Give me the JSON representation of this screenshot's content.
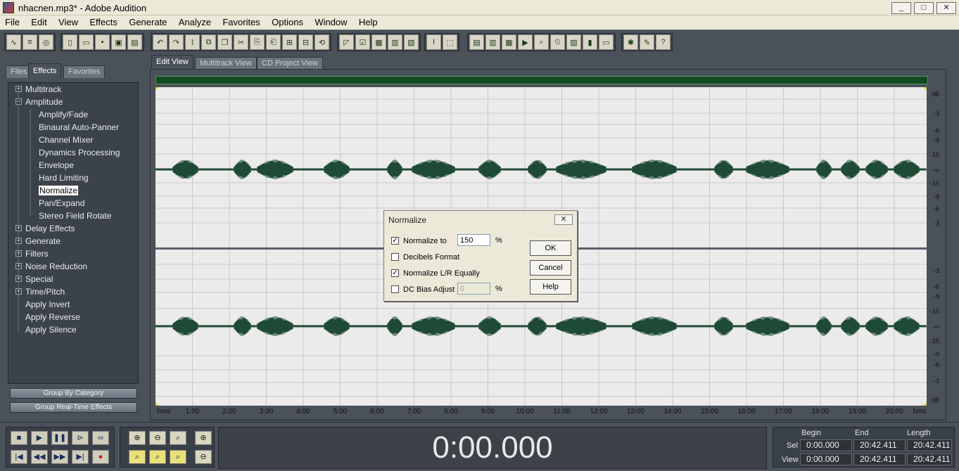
{
  "window": {
    "title": "nhacnen.mp3* - Adobe Audition",
    "controls": {
      "minimize": "_",
      "maximize": "□",
      "close": "✕"
    }
  },
  "menu": [
    "File",
    "Edit",
    "View",
    "Effects",
    "Generate",
    "Analyze",
    "Favorites",
    "Options",
    "Window",
    "Help"
  ],
  "left_panel": {
    "tabs": [
      "Files",
      "Effects",
      "Favorites"
    ],
    "active_tab": "Effects",
    "tree": [
      {
        "label": "Multitrack",
        "level": 0,
        "expander": "+"
      },
      {
        "label": "Amplitude",
        "level": 0,
        "expander": "−"
      },
      {
        "label": "Amplify/Fade",
        "level": 1
      },
      {
        "label": "Binaural Auto-Panner",
        "level": 1
      },
      {
        "label": "Channel Mixer",
        "level": 1
      },
      {
        "label": "Dynamics Processing",
        "level": 1
      },
      {
        "label": "Envelope",
        "level": 1
      },
      {
        "label": "Hard Limiting",
        "level": 1
      },
      {
        "label": "Normalize",
        "level": 1,
        "selected": true
      },
      {
        "label": "Pan/Expand",
        "level": 1
      },
      {
        "label": "Stereo Field Rotate",
        "level": 1
      },
      {
        "label": "Delay Effects",
        "level": 0,
        "expander": "+"
      },
      {
        "label": "Generate",
        "level": 0,
        "expander": "+"
      },
      {
        "label": "Filters",
        "level": 0,
        "expander": "+"
      },
      {
        "label": "Noise Reduction",
        "level": 0,
        "expander": "+"
      },
      {
        "label": "Special",
        "level": 0,
        "expander": "+"
      },
      {
        "label": "Time/Pitch",
        "level": 0,
        "expander": "+"
      },
      {
        "label": "Apply Invert",
        "level": 0
      },
      {
        "label": "Apply Reverse",
        "level": 0
      },
      {
        "label": "Apply Silence",
        "level": 0
      }
    ],
    "buttons": {
      "group_by_category": "Group By Category",
      "group_realtime": "Group Real-Time Effects"
    }
  },
  "view_tabs": [
    "Edit View",
    "Multitrack View",
    "CD Project View"
  ],
  "waveform": {
    "db_scale_top": [
      "dB",
      "-3",
      "-6",
      "-9",
      "-15",
      "-∞",
      "-15",
      "-9",
      "-6",
      "-3"
    ],
    "db_scale_bottom": [
      "-3",
      "-6",
      "-9",
      "-15",
      "-∞",
      "-15",
      "-9",
      "-6",
      "-3",
      "dB"
    ],
    "time_ruler": [
      "hms",
      "1:00",
      "2:00",
      "3:00",
      "4:00",
      "5:00",
      "6:00",
      "7:00",
      "8:00",
      "9:00",
      "10:00",
      "11:00",
      "12:00",
      "13:00",
      "14:00",
      "15:00",
      "16:00",
      "17:00",
      "18:00",
      "19:00",
      "20:00",
      "hms"
    ],
    "colors": {
      "background": "#ebebeb",
      "wave": "#1f4a35",
      "grid": "#c8c8c8"
    }
  },
  "dialog": {
    "title": "Normalize",
    "close": "✕",
    "normalize_to": {
      "label": "Normalize to",
      "checked": true,
      "value": "150",
      "unit": "%"
    },
    "decibels_format": {
      "label": "Decibels Format",
      "checked": false
    },
    "normalize_lr": {
      "label": "Normalize L/R Equally",
      "checked": true
    },
    "dc_bias": {
      "label": "DC Bias Adjust",
      "checked": false,
      "value": "0",
      "unit": "%"
    },
    "buttons": {
      "ok": "OK",
      "cancel": "Cancel",
      "help": "Help"
    }
  },
  "transport": {
    "time": "0:00.000",
    "selection": {
      "headers": {
        "begin": "Begin",
        "end": "End",
        "length": "Length"
      },
      "sel": {
        "label": "Sel",
        "begin": "0:00.000",
        "end": "20:42.411",
        "length": "20:42.411"
      },
      "view": {
        "label": "View",
        "begin": "0:00.000",
        "end": "20:42.411",
        "length": "20:42.411"
      }
    }
  }
}
